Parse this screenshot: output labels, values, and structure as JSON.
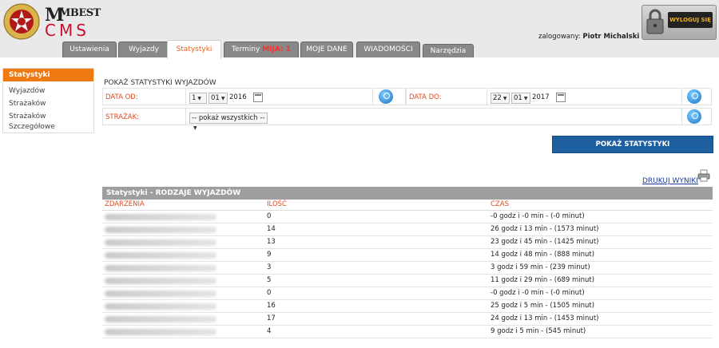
{
  "header": {
    "brand_top": "MBEST",
    "brand_bottom": "CMS",
    "user_label": "zalogowany:",
    "user_name": "Piotr Michalski",
    "logout_label": "WYLOGUJ SIĘ"
  },
  "tabs": [
    {
      "label": "Ustawienia"
    },
    {
      "label": "Wyjazdy"
    },
    {
      "label": "Statystyki"
    },
    {
      "label": "Terminy",
      "badge": "MIJA: 1"
    },
    {
      "label": "MOJE DANE"
    },
    {
      "label": "WIADOMOŚCI"
    },
    {
      "label": "Narzędzia"
    }
  ],
  "sidebar": {
    "title": "Statystyki",
    "items": [
      "Wyjazdów",
      "Strażaków",
      "Strażaków Szczegółowe"
    ]
  },
  "form": {
    "title": "POKAŻ STATYSTYKI WYJAZDÓW",
    "date_from_label": "DATA OD:",
    "date_from": {
      "day": "1",
      "month": "01",
      "year": "2016"
    },
    "date_to_label": "DATA DO:",
    "date_to": {
      "day": "22",
      "month": "01",
      "year": "2017"
    },
    "firefighter_label": "STRAŻAK:",
    "firefighter_value": "-- pokaż wszystkich --",
    "submit_label": "POKAŻ STATYSTYKI"
  },
  "print_label": "DRUKUJ WYNIKI",
  "results": {
    "title": "Statystyki - RODZAJE WYJAZDÓW",
    "columns": [
      "ZDARZENIA",
      "ILOŚĆ",
      "CZAS"
    ],
    "rows": [
      {
        "count": "0",
        "time": "-0 godz i -0 min - (-0 minut)"
      },
      {
        "count": "14",
        "time": "26 godz i 13 min - (1573 minut)"
      },
      {
        "count": "13",
        "time": "23 godz i 45 min - (1425 minut)"
      },
      {
        "count": "9",
        "time": "14 godz i 48 min - (888 minut)"
      },
      {
        "count": "3",
        "time": "3 godz i 59 min - (239 minut)"
      },
      {
        "count": "5",
        "time": "11 godz i 29 min - (689 minut)"
      },
      {
        "count": "0",
        "time": "-0 godz i -0 min - (-0 minut)"
      },
      {
        "count": "16",
        "time": "25 godz i 5 min - (1505 minut)"
      },
      {
        "count": "17",
        "time": "24 godz i 13 min - (1453 minut)"
      },
      {
        "count": "4",
        "time": "9 godz i 5 min - (545 minut)"
      }
    ]
  }
}
